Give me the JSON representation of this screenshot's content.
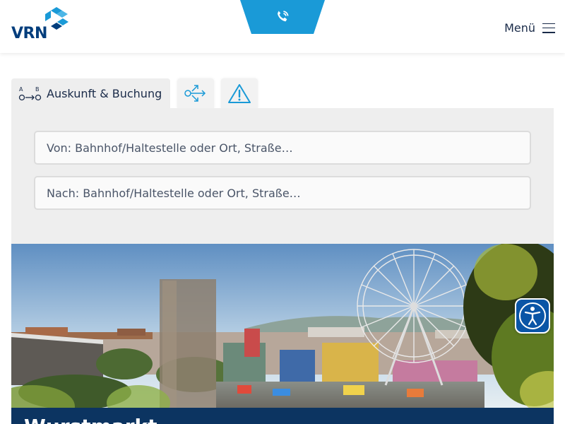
{
  "header": {
    "logo_text": "VRN",
    "menu_label": "Menü",
    "brand_color": "#1a9ad7",
    "logo_color": "#003d7c"
  },
  "tabs": {
    "active_label": "Auskunft & Buchung",
    "icons": [
      "route-ab-icon",
      "connection-icon",
      "warning-icon"
    ]
  },
  "search": {
    "from_placeholder": "Von: Bahnhof/Haltestelle oder Ort, Straße…",
    "to_placeholder": "Nach: Bahnhof/Haltestelle oder Ort, Straße…"
  },
  "hero": {
    "title": "Wurstmarkt",
    "image": "fairground-ferris-wheel-photo"
  },
  "accessibility": {
    "icon": "accessibility-person-icon",
    "color": "#0a55a6"
  }
}
